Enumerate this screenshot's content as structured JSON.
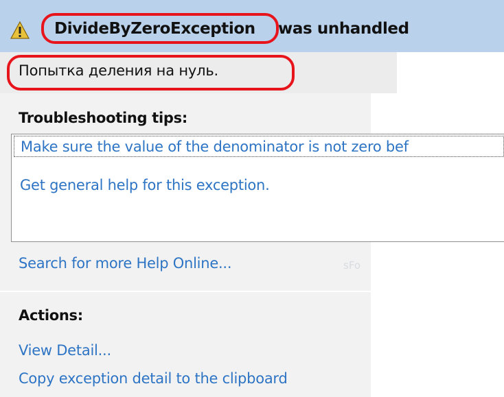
{
  "header": {
    "exception_name": "DivideByZeroException",
    "title_suffix": "was unhandled",
    "icon": "warning-icon"
  },
  "message": "Попытка деления на нуль.",
  "troubleshooting": {
    "heading": "Troubleshooting tips:",
    "tips": [
      "Make sure the value of the denominator is not zero bef",
      "Get general help for this exception."
    ]
  },
  "search_link": "Search for more Help Online...",
  "ghost_text": "sFo",
  "actions": {
    "heading": "Actions:",
    "items": [
      "View Detail...",
      "Copy exception detail to the clipboard"
    ]
  },
  "colors": {
    "titlebar_bg": "#b9d1ea",
    "highlight_oval": "#e8141c",
    "link": "#2e74c4"
  }
}
